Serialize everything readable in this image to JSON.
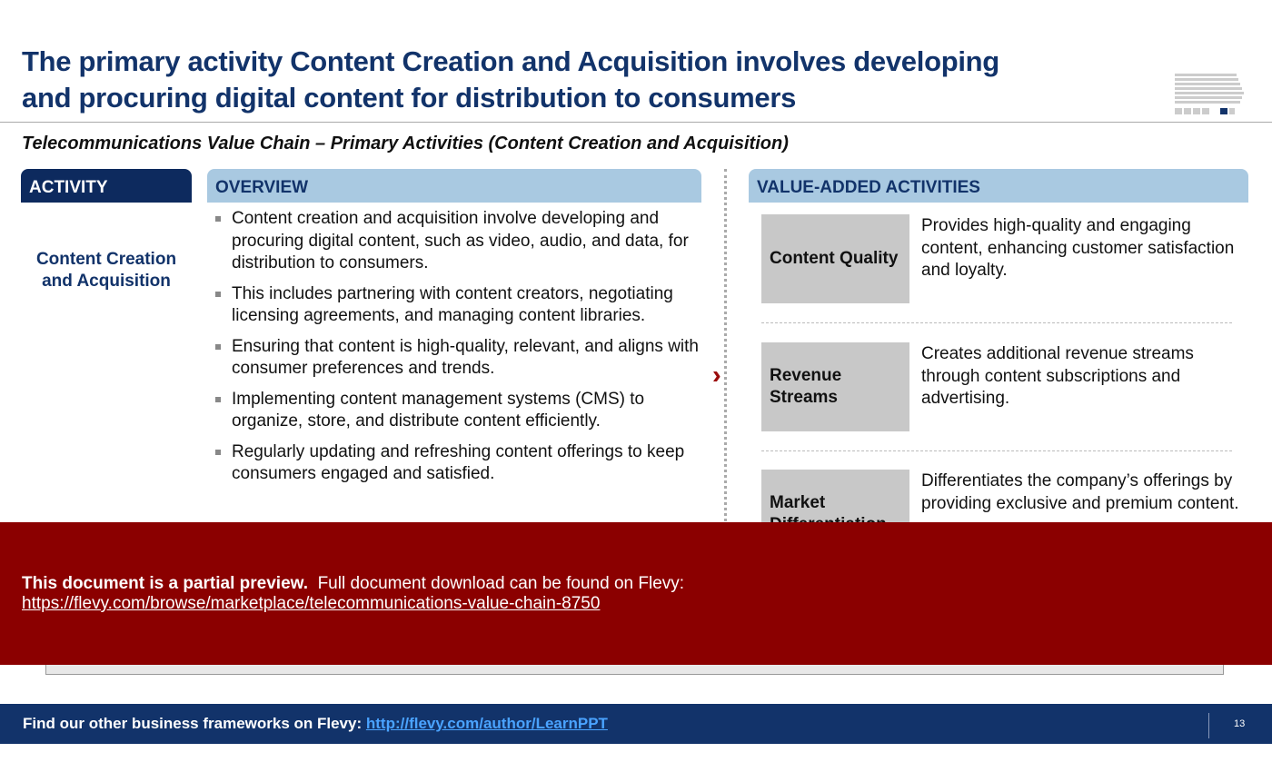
{
  "title": "The primary activity Content Creation and Acquisition involves developing and procuring digital content for distribution to consumers",
  "subtitle": "Telecommunications Value Chain – Primary Activities (Content Creation and Acquisition)",
  "activity": {
    "header": "ACTIVITY",
    "name": "Content Creation and Acquisition"
  },
  "overview": {
    "header": "OVERVIEW",
    "bullets": [
      "Content creation and acquisition involve developing and procuring digital content, such as video, audio, and data, for distribution to consumers.",
      "This includes partnering with content creators, negotiating licensing agreements, and managing content libraries.",
      "Ensuring that content is high-quality, relevant, and aligns with consumer preferences and trends.",
      "Implementing content management systems (CMS) to organize, store, and distribute content efficiently.",
      "Regularly updating and refreshing content offerings to keep consumers engaged and satisfied."
    ]
  },
  "value_added": {
    "header": "VALUE-ADDED ACTIVITIES",
    "items": [
      {
        "label": "Content Quality",
        "desc": "Provides high-quality and engaging content, enhancing customer satisfaction and loyalty."
      },
      {
        "label": "Revenue Streams",
        "desc": "Creates additional revenue streams through content subscriptions and advertising."
      },
      {
        "label": "Market Differentiation",
        "desc": "Differentiates the company’s offerings by providing exclusive and premium content."
      }
    ]
  },
  "preview": {
    "bold": "This document is a partial preview.",
    "text": "Full document download can be found on Flevy:",
    "link": "https://flevy.com/browse/marketplace/telecommunications-value-chain-8750"
  },
  "footer": {
    "text": "Find our other business frameworks on Flevy:",
    "link": "http://flevy.com/author/LearnPPT",
    "page": "13"
  },
  "colors": {
    "navy": "#12336a",
    "light_blue": "#a9c9e1",
    "red": "#8b0000"
  }
}
